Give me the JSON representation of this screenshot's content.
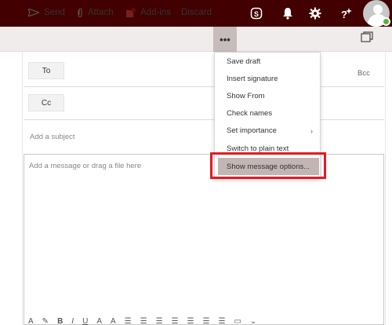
{
  "header": {
    "icons": [
      "skype-icon",
      "bell-icon",
      "gear-icon",
      "help-sparkle-icon"
    ],
    "accent_color": "#430000"
  },
  "toolbar": {
    "send_label": "Send",
    "attach_label": "Attach",
    "addins_label": "Add-ins",
    "discard_label": "Discard",
    "more_label": "•••"
  },
  "compose": {
    "to_label": "To",
    "cc_label": "Cc",
    "bcc_label": "Bcc",
    "subject_placeholder": "Add a subject",
    "body_placeholder": "Add a message or drag a file here"
  },
  "more_menu": {
    "items": [
      {
        "label": "Save draft"
      },
      {
        "label": "Insert signature"
      },
      {
        "label": "Show From"
      },
      {
        "label": "Check names"
      },
      {
        "label": "Set importance"
      },
      {
        "label": "Switch to plain text"
      },
      {
        "label": "Show message options..."
      }
    ],
    "highlight_color": "#e21b23"
  },
  "format_toolbar": {
    "labels": [
      "A",
      "A",
      "B",
      "I",
      "U",
      "A",
      "A"
    ]
  }
}
